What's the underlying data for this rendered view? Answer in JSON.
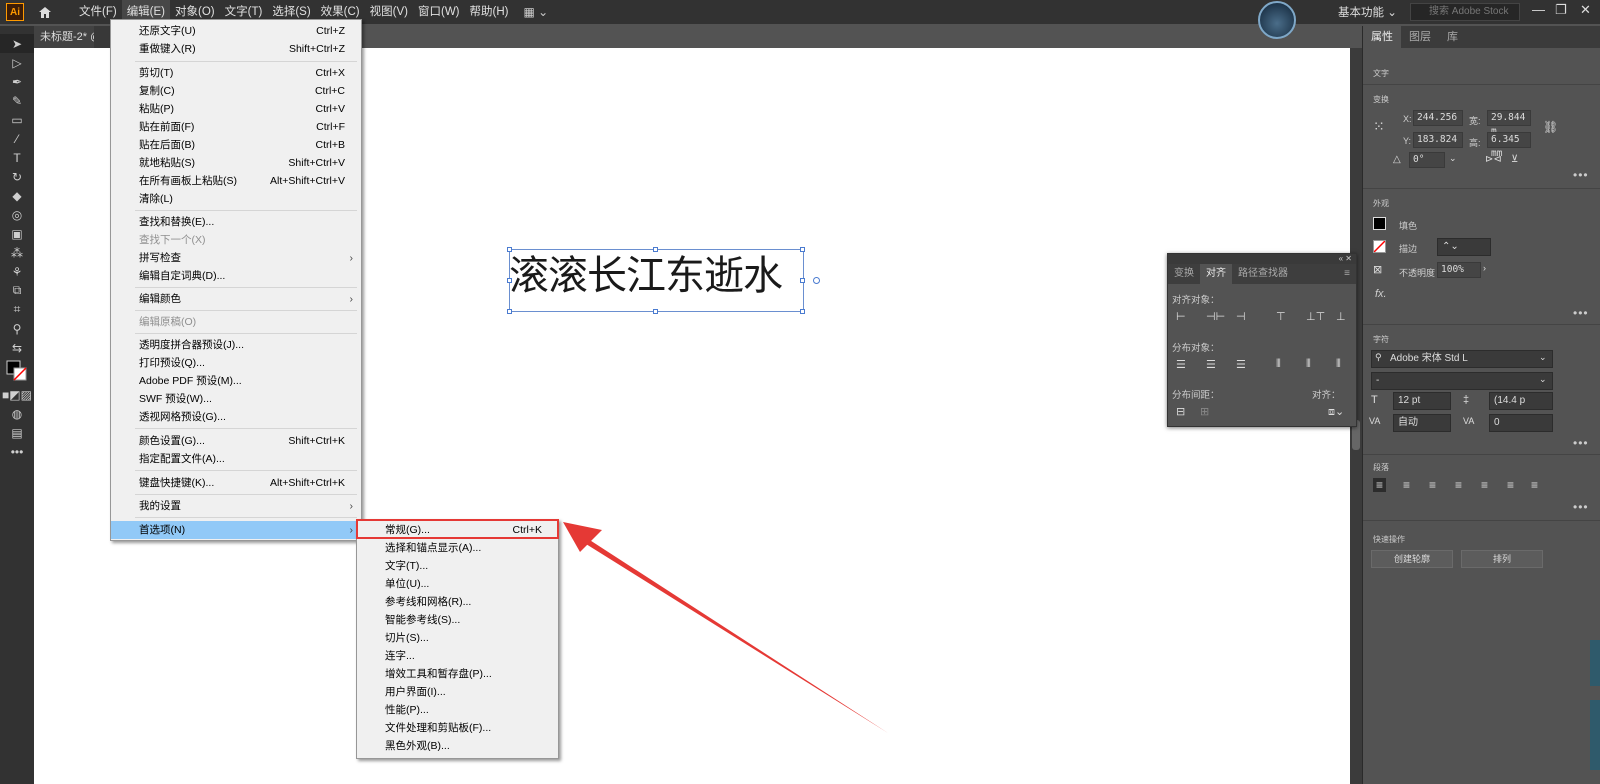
{
  "app": {
    "logo": "Ai",
    "workspace": "基本功能",
    "stock_placeholder": "搜索 Adobe Stock",
    "doc_tab": "未标题-2* @ 3..."
  },
  "menubar": [
    "文件(F)",
    "编辑(E)",
    "对象(O)",
    "文字(T)",
    "选择(S)",
    "效果(C)",
    "视图(V)",
    "窗口(W)",
    "帮助(H)"
  ],
  "edit_menu": [
    {
      "label": "还原文字(U)",
      "shortcut": "Ctrl+Z"
    },
    {
      "label": "重做键入(R)",
      "shortcut": "Shift+Ctrl+Z"
    },
    {
      "label": "剪切(T)",
      "shortcut": "Ctrl+X"
    },
    {
      "label": "复制(C)",
      "shortcut": "Ctrl+C"
    },
    {
      "label": "粘贴(P)",
      "shortcut": "Ctrl+V"
    },
    {
      "label": "贴在前面(F)",
      "shortcut": "Ctrl+F"
    },
    {
      "label": "贴在后面(B)",
      "shortcut": "Ctrl+B"
    },
    {
      "label": "就地粘贴(S)",
      "shortcut": "Shift+Ctrl+V"
    },
    {
      "label": "在所有画板上粘贴(S)",
      "shortcut": "Alt+Shift+Ctrl+V"
    },
    {
      "label": "清除(L)",
      "shortcut": ""
    },
    {
      "label": "查找和替换(E)...",
      "shortcut": ""
    },
    {
      "label": "查找下一个(X)",
      "shortcut": ""
    },
    {
      "label": "拼写检查",
      "shortcut": ""
    },
    {
      "label": "编辑自定词典(D)...",
      "shortcut": ""
    },
    {
      "label": "编辑颜色",
      "shortcut": ""
    },
    {
      "label": "编辑原稿(O)",
      "shortcut": ""
    },
    {
      "label": "透明度拼合器预设(J)...",
      "shortcut": ""
    },
    {
      "label": "打印预设(Q)...",
      "shortcut": ""
    },
    {
      "label": "Adobe PDF 预设(M)...",
      "shortcut": ""
    },
    {
      "label": "SWF 预设(W)...",
      "shortcut": ""
    },
    {
      "label": "透视网格预设(G)...",
      "shortcut": ""
    },
    {
      "label": "颜色设置(G)...",
      "shortcut": "Shift+Ctrl+K"
    },
    {
      "label": "指定配置文件(A)...",
      "shortcut": ""
    },
    {
      "label": "键盘快捷键(K)...",
      "shortcut": "Alt+Shift+Ctrl+K"
    },
    {
      "label": "我的设置",
      "shortcut": ""
    },
    {
      "label": "首选项(N)",
      "shortcut": ""
    }
  ],
  "prefs_submenu": [
    {
      "label": "常规(G)...",
      "shortcut": "Ctrl+K"
    },
    {
      "label": "选择和锚点显示(A)...",
      "shortcut": ""
    },
    {
      "label": "文字(T)...",
      "shortcut": ""
    },
    {
      "label": "单位(U)...",
      "shortcut": ""
    },
    {
      "label": "参考线和网格(R)...",
      "shortcut": ""
    },
    {
      "label": "智能参考线(S)...",
      "shortcut": ""
    },
    {
      "label": "切片(S)...",
      "shortcut": ""
    },
    {
      "label": "连字...",
      "shortcut": ""
    },
    {
      "label": "增效工具和暂存盘(P)...",
      "shortcut": ""
    },
    {
      "label": "用户界面(I)...",
      "shortcut": ""
    },
    {
      "label": "性能(P)...",
      "shortcut": ""
    },
    {
      "label": "文件处理和剪贴板(F)...",
      "shortcut": ""
    },
    {
      "label": "黑色外观(B)...",
      "shortcut": ""
    }
  ],
  "canvas": {
    "text": "滚滚长江东逝水"
  },
  "align_panel": {
    "tabs": [
      "变换",
      "对齐",
      "路径查找器"
    ],
    "align_objects": "对齐对象：",
    "distribute_objects": "分布对象：",
    "distribute_spacing": "分布间距：",
    "align_to": "对齐："
  },
  "properties": {
    "tabs": [
      "属性",
      "图层",
      "库"
    ],
    "type_label": "文字",
    "transform_label": "变换",
    "x": "244.256",
    "y": "183.824",
    "w": "29.844 m",
    "h": "6.345 mm",
    "angle": "0°",
    "x_lbl": "X:",
    "y_lbl": "Y:",
    "w_lbl": "宽:",
    "h_lbl": "高:",
    "appearance_label": "外观",
    "fill_label": "填色",
    "stroke_label": "描边",
    "opacity_label": "不透明度",
    "opacity": "100%",
    "fx": "fx.",
    "character_label": "字符",
    "font": "Adobe 宋体 Std L",
    "font_style": "-",
    "size": "12 pt",
    "leading": "(14.4 p",
    "kerning": "自动",
    "tracking": "0",
    "paragraph_label": "段落",
    "quick_label": "快速操作",
    "btn_outline": "创建轮廓",
    "btn_arrange": "排列"
  },
  "colors": {
    "highlight": "#91c9f7",
    "annotation": "#e53935",
    "accent": "#ff9a00"
  }
}
